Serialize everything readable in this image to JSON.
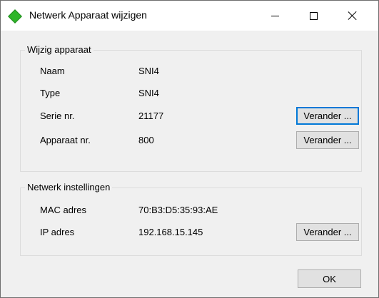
{
  "window": {
    "title": "Netwerk Apparaat wijzigen",
    "icon": "green-diamond-icon",
    "accent_color": "#0078d7",
    "icon_color": "#2fb52a"
  },
  "device_group": {
    "title": "Wijzig apparaat",
    "name_label": "Naam",
    "name_value": "SNI4",
    "type_label": "Type",
    "type_value": "SNI4",
    "serial_label": "Serie nr.",
    "serial_value": "21177",
    "serial_change_label": "Verander ...",
    "device_label": "Apparaat nr.",
    "device_value": "800",
    "device_change_label": "Verander ..."
  },
  "network_group": {
    "title": "Netwerk instellingen",
    "mac_label": "MAC adres",
    "mac_value": "70:B3:D5:35:93:AE",
    "ip_label": "IP adres",
    "ip_value": "192.168.15.145",
    "ip_change_label": "Verander ..."
  },
  "footer": {
    "ok_label": "OK"
  }
}
